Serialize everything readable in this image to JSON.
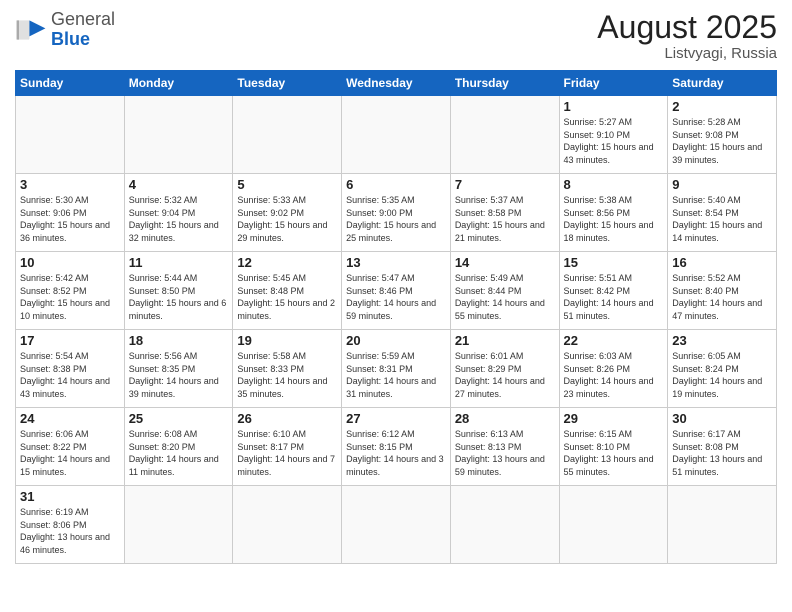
{
  "header": {
    "logo_general": "General",
    "logo_blue": "Blue",
    "month_year": "August 2025",
    "location": "Listvyagi, Russia"
  },
  "weekdays": [
    "Sunday",
    "Monday",
    "Tuesday",
    "Wednesday",
    "Thursday",
    "Friday",
    "Saturday"
  ],
  "weeks": [
    [
      {
        "day": "",
        "info": ""
      },
      {
        "day": "",
        "info": ""
      },
      {
        "day": "",
        "info": ""
      },
      {
        "day": "",
        "info": ""
      },
      {
        "day": "",
        "info": ""
      },
      {
        "day": "1",
        "info": "Sunrise: 5:27 AM\nSunset: 9:10 PM\nDaylight: 15 hours\nand 43 minutes."
      },
      {
        "day": "2",
        "info": "Sunrise: 5:28 AM\nSunset: 9:08 PM\nDaylight: 15 hours\nand 39 minutes."
      }
    ],
    [
      {
        "day": "3",
        "info": "Sunrise: 5:30 AM\nSunset: 9:06 PM\nDaylight: 15 hours\nand 36 minutes."
      },
      {
        "day": "4",
        "info": "Sunrise: 5:32 AM\nSunset: 9:04 PM\nDaylight: 15 hours\nand 32 minutes."
      },
      {
        "day": "5",
        "info": "Sunrise: 5:33 AM\nSunset: 9:02 PM\nDaylight: 15 hours\nand 29 minutes."
      },
      {
        "day": "6",
        "info": "Sunrise: 5:35 AM\nSunset: 9:00 PM\nDaylight: 15 hours\nand 25 minutes."
      },
      {
        "day": "7",
        "info": "Sunrise: 5:37 AM\nSunset: 8:58 PM\nDaylight: 15 hours\nand 21 minutes."
      },
      {
        "day": "8",
        "info": "Sunrise: 5:38 AM\nSunset: 8:56 PM\nDaylight: 15 hours\nand 18 minutes."
      },
      {
        "day": "9",
        "info": "Sunrise: 5:40 AM\nSunset: 8:54 PM\nDaylight: 15 hours\nand 14 minutes."
      }
    ],
    [
      {
        "day": "10",
        "info": "Sunrise: 5:42 AM\nSunset: 8:52 PM\nDaylight: 15 hours\nand 10 minutes."
      },
      {
        "day": "11",
        "info": "Sunrise: 5:44 AM\nSunset: 8:50 PM\nDaylight: 15 hours\nand 6 minutes."
      },
      {
        "day": "12",
        "info": "Sunrise: 5:45 AM\nSunset: 8:48 PM\nDaylight: 15 hours\nand 2 minutes."
      },
      {
        "day": "13",
        "info": "Sunrise: 5:47 AM\nSunset: 8:46 PM\nDaylight: 14 hours\nand 59 minutes."
      },
      {
        "day": "14",
        "info": "Sunrise: 5:49 AM\nSunset: 8:44 PM\nDaylight: 14 hours\nand 55 minutes."
      },
      {
        "day": "15",
        "info": "Sunrise: 5:51 AM\nSunset: 8:42 PM\nDaylight: 14 hours\nand 51 minutes."
      },
      {
        "day": "16",
        "info": "Sunrise: 5:52 AM\nSunset: 8:40 PM\nDaylight: 14 hours\nand 47 minutes."
      }
    ],
    [
      {
        "day": "17",
        "info": "Sunrise: 5:54 AM\nSunset: 8:38 PM\nDaylight: 14 hours\nand 43 minutes."
      },
      {
        "day": "18",
        "info": "Sunrise: 5:56 AM\nSunset: 8:35 PM\nDaylight: 14 hours\nand 39 minutes."
      },
      {
        "day": "19",
        "info": "Sunrise: 5:58 AM\nSunset: 8:33 PM\nDaylight: 14 hours\nand 35 minutes."
      },
      {
        "day": "20",
        "info": "Sunrise: 5:59 AM\nSunset: 8:31 PM\nDaylight: 14 hours\nand 31 minutes."
      },
      {
        "day": "21",
        "info": "Sunrise: 6:01 AM\nSunset: 8:29 PM\nDaylight: 14 hours\nand 27 minutes."
      },
      {
        "day": "22",
        "info": "Sunrise: 6:03 AM\nSunset: 8:26 PM\nDaylight: 14 hours\nand 23 minutes."
      },
      {
        "day": "23",
        "info": "Sunrise: 6:05 AM\nSunset: 8:24 PM\nDaylight: 14 hours\nand 19 minutes."
      }
    ],
    [
      {
        "day": "24",
        "info": "Sunrise: 6:06 AM\nSunset: 8:22 PM\nDaylight: 14 hours\nand 15 minutes."
      },
      {
        "day": "25",
        "info": "Sunrise: 6:08 AM\nSunset: 8:20 PM\nDaylight: 14 hours\nand 11 minutes."
      },
      {
        "day": "26",
        "info": "Sunrise: 6:10 AM\nSunset: 8:17 PM\nDaylight: 14 hours\nand 7 minutes."
      },
      {
        "day": "27",
        "info": "Sunrise: 6:12 AM\nSunset: 8:15 PM\nDaylight: 14 hours\nand 3 minutes."
      },
      {
        "day": "28",
        "info": "Sunrise: 6:13 AM\nSunset: 8:13 PM\nDaylight: 13 hours\nand 59 minutes."
      },
      {
        "day": "29",
        "info": "Sunrise: 6:15 AM\nSunset: 8:10 PM\nDaylight: 13 hours\nand 55 minutes."
      },
      {
        "day": "30",
        "info": "Sunrise: 6:17 AM\nSunset: 8:08 PM\nDaylight: 13 hours\nand 51 minutes."
      }
    ],
    [
      {
        "day": "31",
        "info": "Sunrise: 6:19 AM\nSunset: 8:06 PM\nDaylight: 13 hours\nand 46 minutes."
      },
      {
        "day": "",
        "info": ""
      },
      {
        "day": "",
        "info": ""
      },
      {
        "day": "",
        "info": ""
      },
      {
        "day": "",
        "info": ""
      },
      {
        "day": "",
        "info": ""
      },
      {
        "day": "",
        "info": ""
      }
    ]
  ]
}
